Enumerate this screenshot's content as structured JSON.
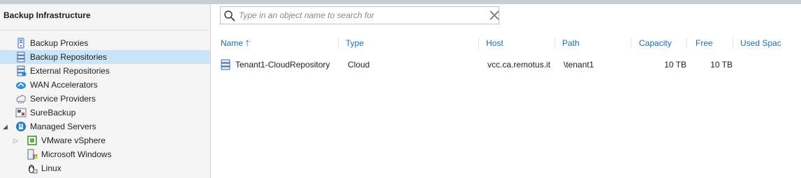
{
  "pane": {
    "title": "Backup Infrastructure"
  },
  "tree": [
    {
      "label": "Backup Proxies",
      "icon": "backup-proxy-icon"
    },
    {
      "label": "Backup Repositories",
      "icon": "backup-repository-icon",
      "selected": true
    },
    {
      "label": "External Repositories",
      "icon": "external-repository-icon"
    },
    {
      "label": "WAN Accelerators",
      "icon": "wan-accelerator-icon"
    },
    {
      "label": "Service Providers",
      "icon": "service-provider-icon"
    },
    {
      "label": "SureBackup",
      "icon": "surebackup-icon"
    },
    {
      "label": "Managed Servers",
      "icon": "managed-servers-icon",
      "expanded": true
    },
    {
      "label": "VMware vSphere",
      "icon": "vmware-icon",
      "collapsed": true
    },
    {
      "label": "Microsoft Windows",
      "icon": "windows-server-icon"
    },
    {
      "label": "Linux",
      "icon": "linux-icon"
    }
  ],
  "search": {
    "placeholder": "Type in an object name to search for",
    "value": ""
  },
  "grid": {
    "columns": [
      "Name",
      "Type",
      "Host",
      "Path",
      "Capacity",
      "Free",
      "Used Spac"
    ],
    "sort_column": "Name",
    "sort_direction": "ascending",
    "rows": [
      {
        "name": "Tenant1-CloudRepository",
        "type": "Cloud",
        "host": "vcc.ca.remotus.it",
        "path": "\\tenant1",
        "capacity": "10 TB",
        "free": "10 TB",
        "used": ""
      }
    ]
  },
  "colors": {
    "selection": "#cce4f7",
    "accent": "#1a6fb5",
    "pane_background": "#f5f5f5"
  }
}
